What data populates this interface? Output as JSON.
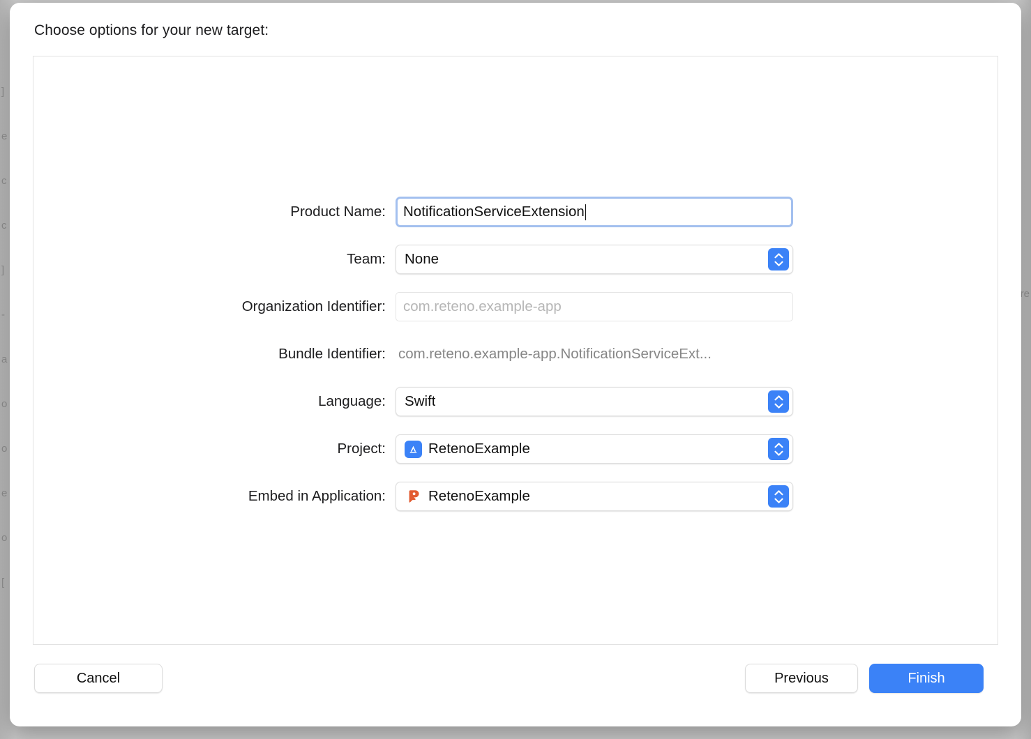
{
  "background": {
    "left_text": [
      "]",
      "e",
      "c",
      "c",
      "]",
      "-",
      "a",
      "o",
      "o",
      "e",
      "o",
      "["
    ],
    "right_text": [
      "re"
    ]
  },
  "dialog": {
    "title": "Choose options for your new target:",
    "accent_color": "#3b82f7",
    "focus_ring_color": "#a3c0ef"
  },
  "form": {
    "rows": [
      {
        "label": "Product Name:",
        "kind": "textfield-focused",
        "value": "NotificationServiceExtension",
        "name": "product-name"
      },
      {
        "label": "Team:",
        "kind": "popup",
        "value": "None",
        "name": "team"
      },
      {
        "label": "Organization Identifier:",
        "kind": "textfield-placeholder",
        "value": "",
        "placeholder": "com.reteno.example-app",
        "name": "organization-identifier"
      },
      {
        "label": "Bundle Identifier:",
        "kind": "static",
        "value": "com.reteno.example-app.NotificationServiceExt...",
        "name": "bundle-identifier"
      },
      {
        "label": "Language:",
        "kind": "popup",
        "value": "Swift",
        "name": "language"
      },
      {
        "label": "Project:",
        "kind": "popup-icon",
        "value": "RetenoExample",
        "icon": "app-store-icon",
        "name": "project"
      },
      {
        "label": "Embed in Application:",
        "kind": "popup-icon",
        "value": "RetenoExample",
        "icon": "reteno-app-icon",
        "name": "embed-in-application"
      }
    ]
  },
  "footer": {
    "cancel_label": "Cancel",
    "previous_label": "Previous",
    "finish_label": "Finish"
  }
}
